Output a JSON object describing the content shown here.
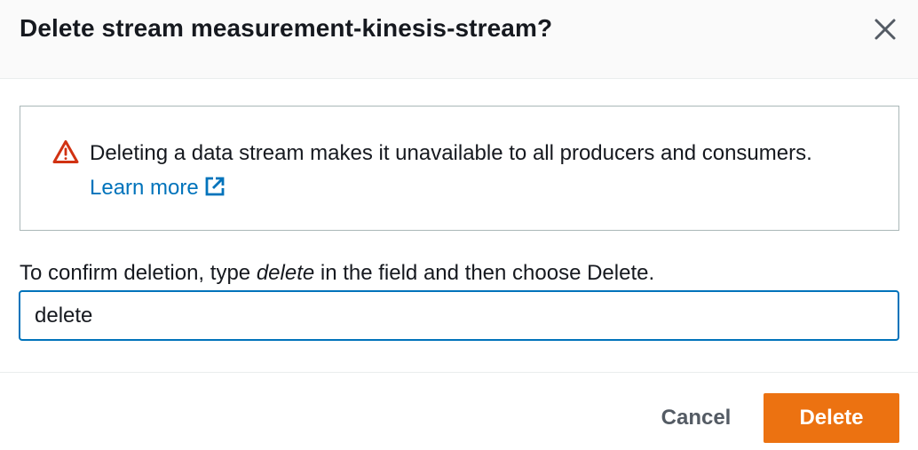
{
  "dialog": {
    "title": "Delete stream measurement-kinesis-stream?"
  },
  "alert": {
    "icon": "warning-triangle-icon",
    "message": "Deleting a data stream makes it unavailable to all producers and consumers.",
    "link_label": "Learn more",
    "link_icon": "external-link-icon"
  },
  "confirm": {
    "label_before": "To confirm deletion, type ",
    "label_keyword": "delete",
    "label_after": " in the field and then choose Delete.",
    "input_value": "delete"
  },
  "footer": {
    "cancel_label": "Cancel",
    "delete_label": "Delete"
  },
  "colors": {
    "accent_link": "#0073bb",
    "primary_button": "#ec7211",
    "warning": "#d13212"
  }
}
